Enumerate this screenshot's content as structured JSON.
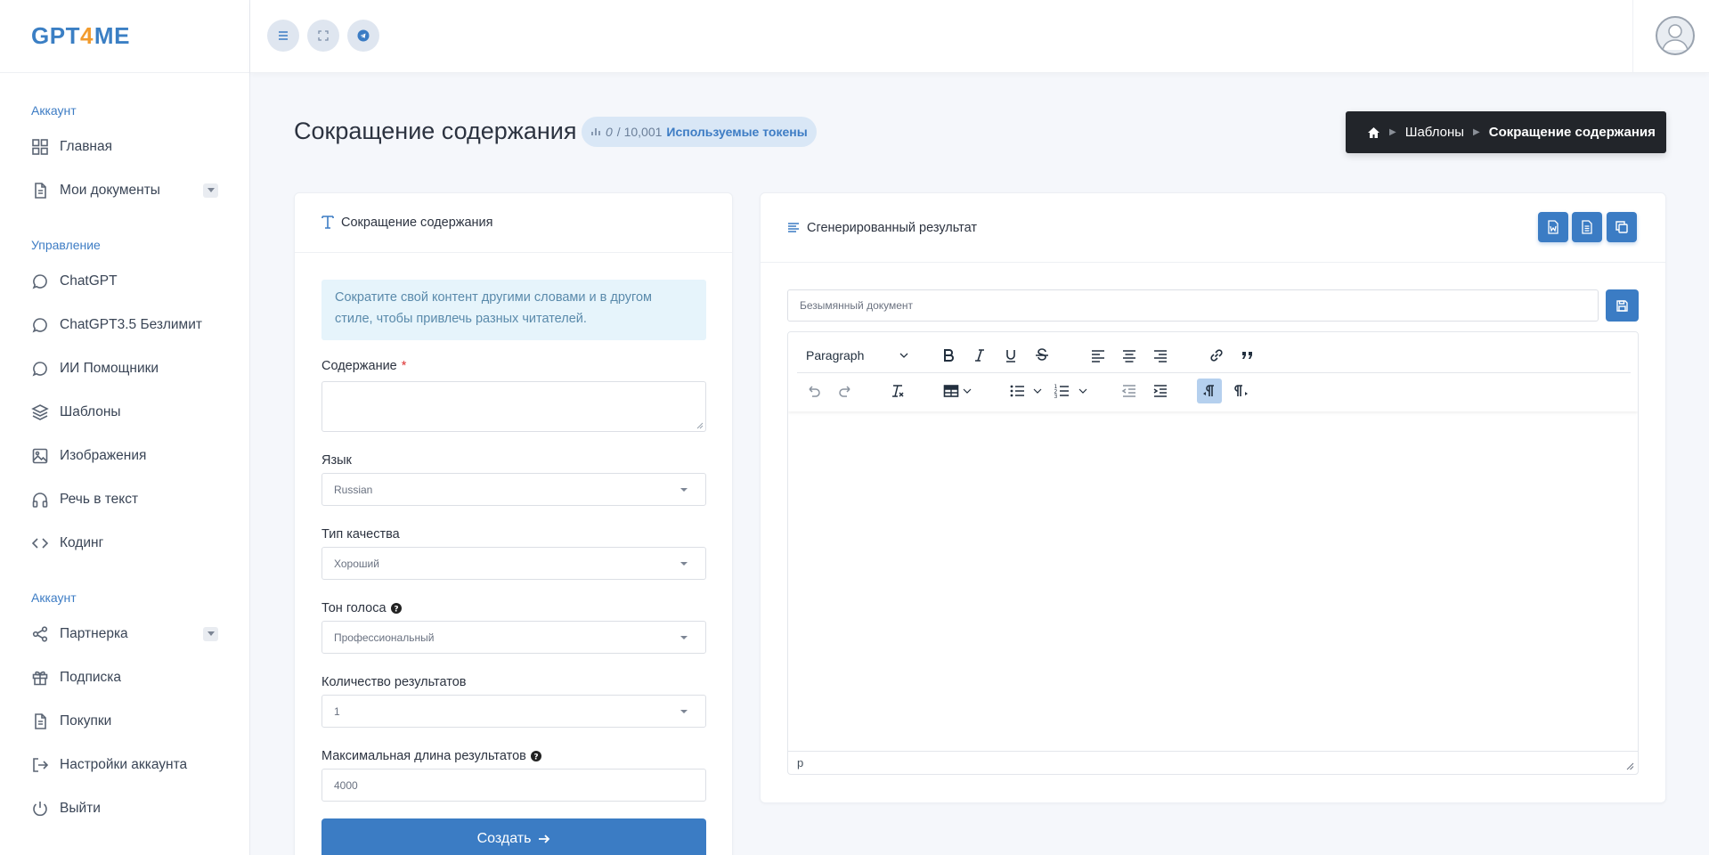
{
  "brand": {
    "part1": "GPT",
    "part2": "4",
    "part3": "ME"
  },
  "sidebar": {
    "sections": [
      {
        "title": "Аккаунт",
        "items": [
          {
            "label": "Главная",
            "icon": "grid-icon"
          },
          {
            "label": "Мои документы",
            "icon": "file-icon",
            "has_caret": true
          }
        ]
      },
      {
        "title": "Управление",
        "items": [
          {
            "label": "ChatGPT",
            "icon": "chat-icon"
          },
          {
            "label": "ChatGPT3.5 Безлимит",
            "icon": "chat-icon"
          },
          {
            "label": "ИИ Помощники",
            "icon": "chat-icon"
          },
          {
            "label": "Шаблоны",
            "icon": "layers-icon"
          },
          {
            "label": "Изображения",
            "icon": "image-icon"
          },
          {
            "label": "Речь в текст",
            "icon": "headphones-icon"
          },
          {
            "label": "Кодинг",
            "icon": "code-icon"
          }
        ]
      },
      {
        "title": "Аккаунт",
        "items": [
          {
            "label": "Партнерка",
            "icon": "share-icon",
            "has_caret": true
          },
          {
            "label": "Подписка",
            "icon": "gift-icon"
          },
          {
            "label": "Покупки",
            "icon": "receipt-icon"
          },
          {
            "label": "Настройки аккаунта",
            "icon": "login-icon"
          },
          {
            "label": "Выйти",
            "icon": "power-icon"
          }
        ]
      }
    ]
  },
  "topbar": {
    "buttons": [
      "menu-icon",
      "fullscreen-icon",
      "telegram-icon"
    ]
  },
  "page": {
    "title": "Сокращение содержания",
    "tokens_used": "0",
    "tokens_total": "/ 10,001",
    "tokens_label": "Используемые токены"
  },
  "breadcrumb": {
    "home_icon": "home-icon",
    "parent": "Шаблоны",
    "current": "Сокращение содержания"
  },
  "form": {
    "card_title": "Сокращение содержания",
    "info": "Сократите свой контент другими словами и в другом стиле, чтобы привлечь разных читателей.",
    "content_label": "Содержание",
    "content_required": "*",
    "language_label": "Язык",
    "language_value": "Russian",
    "quality_label": "Тип качества",
    "quality_value": "Хороший",
    "tone_label": "Тон голоса",
    "tone_value": "Профессиональный",
    "count_label": "Количество результатов",
    "count_value": "1",
    "maxlen_label": "Максимальная длина результатов",
    "maxlen_value": "4000",
    "create_label": "Создать"
  },
  "result": {
    "card_title": "Сгенерированный результат",
    "doc_placeholder": "Безымянный документ",
    "format_select": "Paragraph",
    "status_path": "p"
  },
  "colors": {
    "accent": "#3b7cc4",
    "logo_orange": "#f29b2d",
    "breadcrumb_bg": "#22252a",
    "info_bg": "#e6f4fb"
  }
}
